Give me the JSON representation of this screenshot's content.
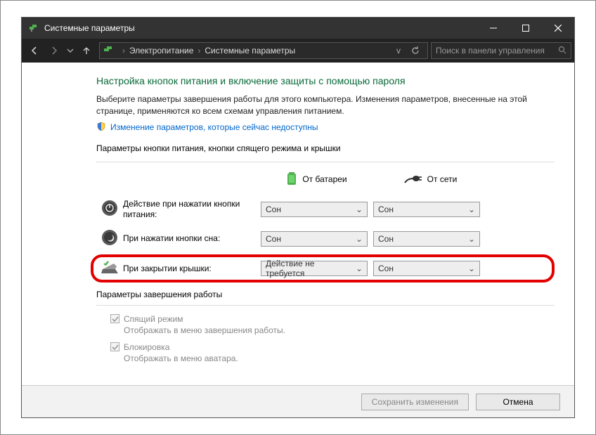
{
  "titlebar": {
    "title": "Системные параметры"
  },
  "breadcrumb": {
    "seg1": "Электропитание",
    "seg2": "Системные параметры"
  },
  "search": {
    "placeholder": "Поиск в панели управления"
  },
  "page": {
    "title": "Настройка кнопок питания и включение защиты с помощью пароля",
    "instructions": "Выберите параметры завершения работы для этого компьютера. Изменения параметров, внесенные на этой странице, применяются ко всем схемам управления питанием.",
    "link": "Изменение параметров, которые сейчас недоступны"
  },
  "section_title": "Параметры кнопки питания, кнопки спящего режима и крышки",
  "columns": {
    "battery": "От батареи",
    "ac": "От сети"
  },
  "rows": {
    "power": {
      "label": "Действие при нажатии кнопки питания:",
      "battery": "Сон",
      "ac": "Сон"
    },
    "sleep": {
      "label": "При нажатии кнопки сна:",
      "battery": "Сон",
      "ac": "Сон"
    },
    "lid": {
      "label": "При закрытии крышки:",
      "battery": "Действие не требуется",
      "ac": "Сон"
    }
  },
  "shutdown": {
    "title": "Параметры завершения работы",
    "sleep_mode": {
      "label": "Спящий режим",
      "desc": "Отображать в меню завершения работы."
    },
    "lock": {
      "label": "Блокировка",
      "desc": "Отображать в меню аватара."
    }
  },
  "buttons": {
    "save": "Сохранить изменения",
    "cancel": "Отмена"
  }
}
